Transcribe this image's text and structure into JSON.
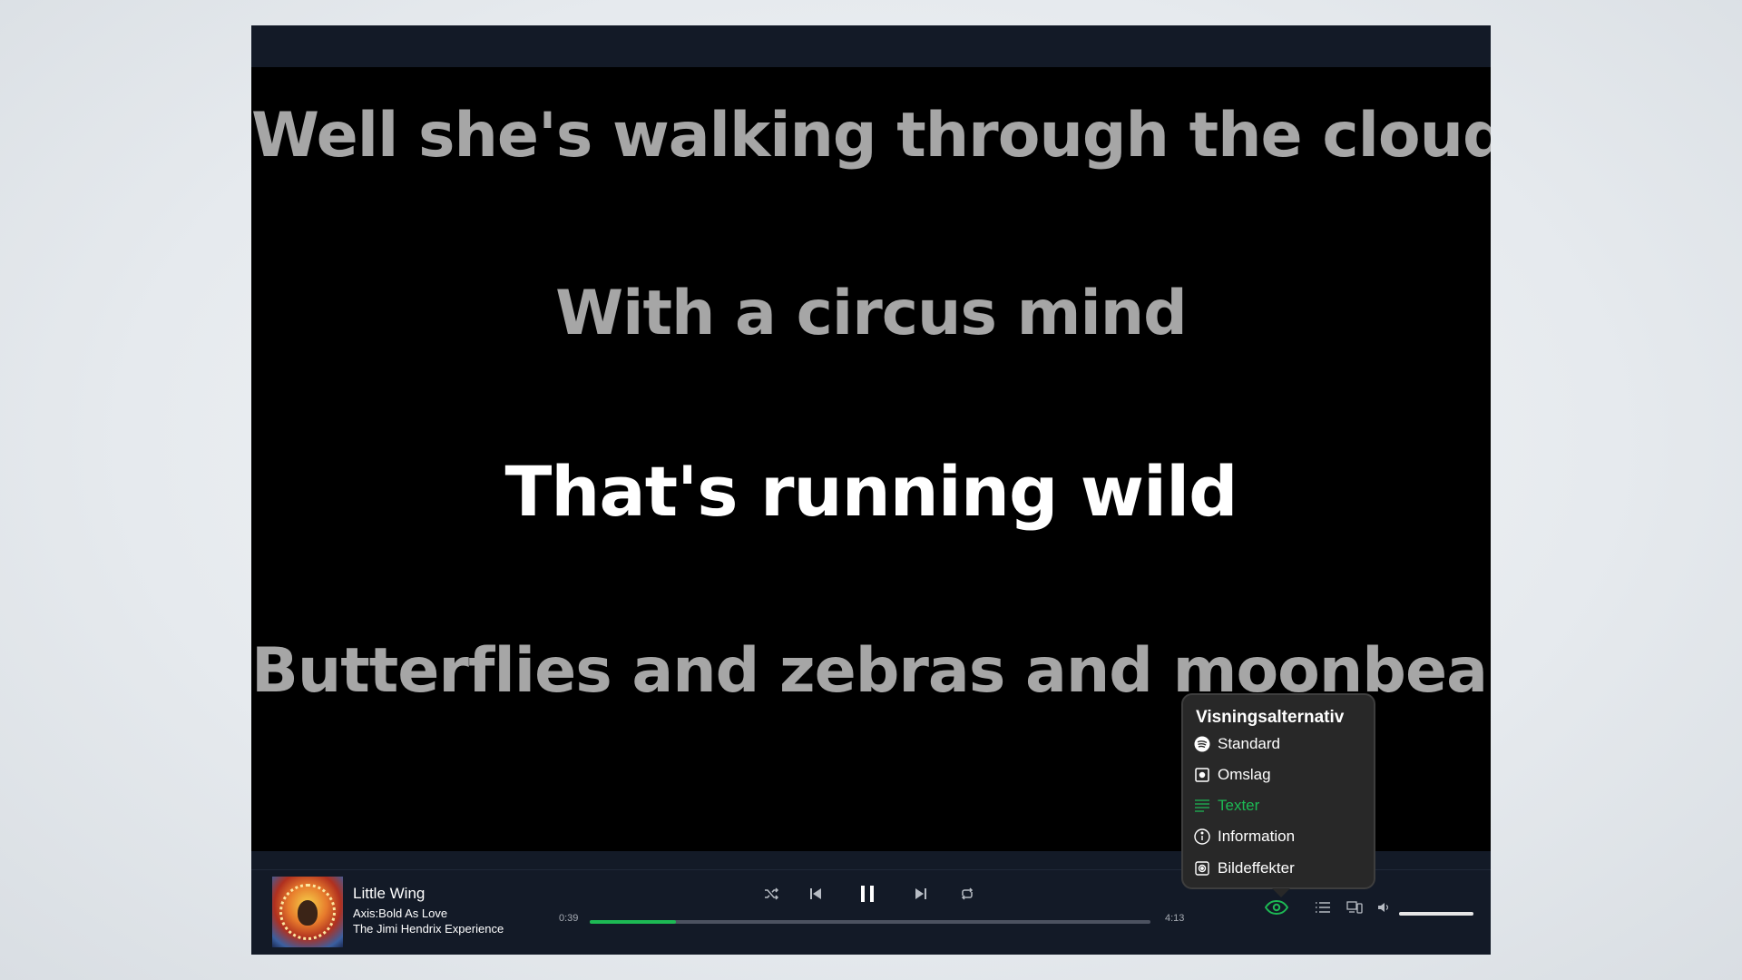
{
  "lyrics": {
    "lines": [
      "Well she's walking through the clouds",
      "With a circus mind",
      "That's running wild",
      "Butterflies and zebras and moonbeams"
    ],
    "active_index": 2
  },
  "now_playing": {
    "title": "Little Wing",
    "album": "Axis:Bold As Love",
    "artist": "The Jimi Hendrix Experience",
    "cover_icon": "album-cover"
  },
  "playback": {
    "elapsed": "0:39",
    "duration": "4:13",
    "progress_fraction": 0.154,
    "volume_fraction": 1.0
  },
  "view_menu": {
    "title": "Visningsalternativ",
    "items": [
      {
        "label": "Standard",
        "icon": "spotify-logo-icon"
      },
      {
        "label": "Omslag",
        "icon": "cover-icon"
      },
      {
        "label": "Texter",
        "icon": "lyrics-icon",
        "active": true
      },
      {
        "label": "Information",
        "icon": "info-icon"
      },
      {
        "label": "Bildeffekter",
        "icon": "image-effects-icon"
      }
    ]
  },
  "colors": {
    "accent": "#1db954",
    "player_bg": "#131a27",
    "lyric_inactive": "#a6a6a6",
    "lyric_active": "#ffffff"
  }
}
